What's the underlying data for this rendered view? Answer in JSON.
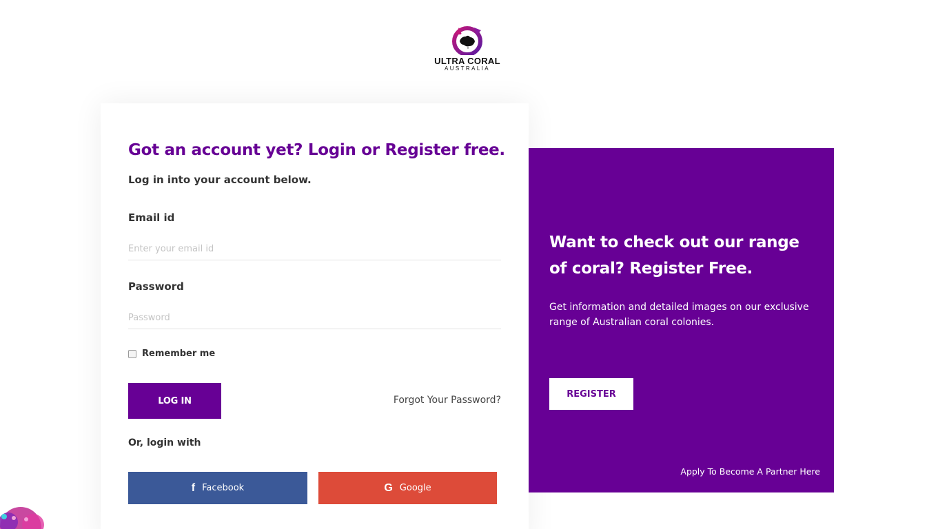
{
  "logo": {
    "line1": "ULTRA CORAL",
    "line2": "AUSTRALIA"
  },
  "login": {
    "title": "Got an account yet? Login or Register free.",
    "subtitle": "Log in into your account below.",
    "email_label": "Email id",
    "email_placeholder": "Enter your email id",
    "email_value": "",
    "password_label": "Password",
    "password_placeholder": "Password",
    "password_value": "",
    "remember_label": "Remember me",
    "remember_checked": false,
    "login_button": "LOG IN",
    "forgot_link": "Forgot Your Password?",
    "or_login_with": "Or, login with",
    "social": {
      "facebook_label": "Facebook",
      "google_label": "Google"
    }
  },
  "register_panel": {
    "title": "Want to check out our range of coral? Register Free.",
    "description": "Get information and detailed images on our exclusive range of Australian coral colonies.",
    "register_button": "REGISTER",
    "partner_link": "Apply To Become A Partner Here"
  },
  "colors": {
    "brand_purple": "#670095",
    "facebook_blue": "#3b5998",
    "google_red": "#dd4b39"
  },
  "icons": {
    "facebook": "facebook-icon",
    "google": "google-icon",
    "logo": "australia-map-logo-icon"
  }
}
